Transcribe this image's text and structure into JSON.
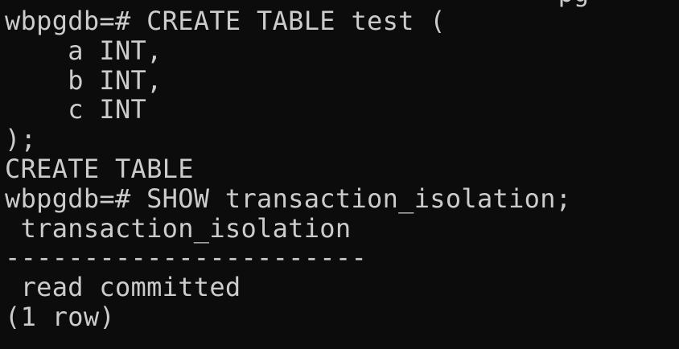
{
  "terminal": {
    "background": "#0c0c0c",
    "foreground": "#cccccc",
    "clipped_top_line": "                                    pg",
    "lines": [
      "wbpgdb=# CREATE TABLE test (",
      "    a INT,",
      "    b INT,",
      "    c INT",
      ");",
      "CREATE TABLE",
      "wbpgdb=# SHOW transaction_isolation;",
      " transaction_isolation",
      "-----------------------",
      " read committed",
      "(1 row)"
    ]
  }
}
